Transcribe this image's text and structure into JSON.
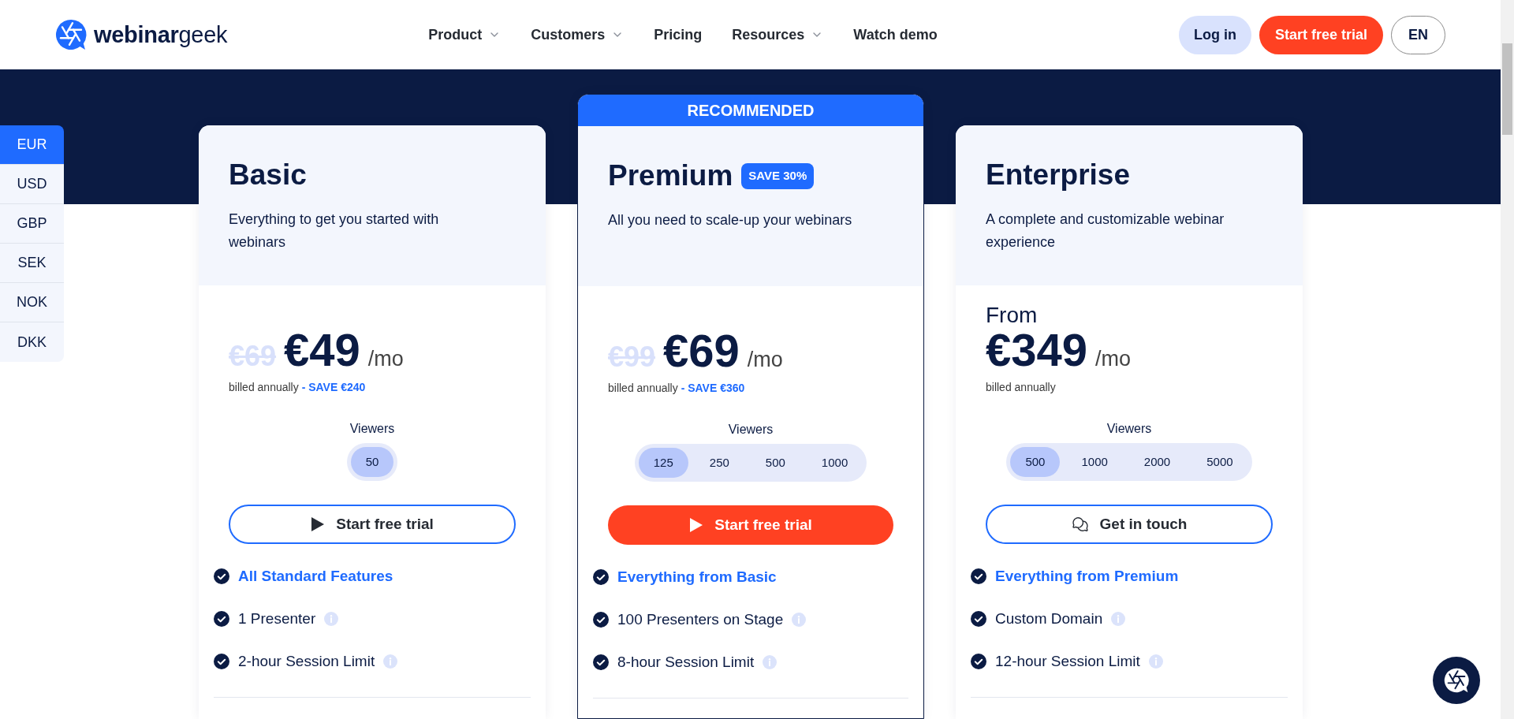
{
  "header": {
    "logo": {
      "wordmark": "**webinar**geek"
    },
    "nav": [
      {
        "label": "Product",
        "dropdown": true
      },
      {
        "label": "Customers",
        "dropdown": true
      },
      {
        "label": "Pricing",
        "dropdown": false
      },
      {
        "label": "Resources",
        "dropdown": true
      },
      {
        "label": "Watch demo",
        "dropdown": false
      }
    ],
    "actions": [
      {
        "label": "Log in",
        "kind": "secondary"
      },
      {
        "label": "Start free trial",
        "kind": "primary"
      },
      {
        "label": "EN",
        "kind": "language"
      }
    ]
  },
  "currencies": [
    {
      "label": "EUR",
      "selected": true
    },
    {
      "label": "USD",
      "selected": false
    },
    {
      "label": "GBP",
      "selected": false
    },
    {
      "label": "SEK",
      "selected": false
    },
    {
      "label": "NOK",
      "selected": false
    },
    {
      "label": "DKK",
      "selected": false
    }
  ],
  "plans": [
    {
      "name": "Basic",
      "description": "Everything to get you started with webinars",
      "highlighted": false,
      "old_price": "€69",
      "price": "€49",
      "period": "/mo",
      "billing": "billed annually **- SAVE €240**",
      "viewers": {
        "label": "Viewers",
        "options": [
          {
            "label": "50",
            "selected": true
          }
        ]
      },
      "cta": {
        "label": "Start free trial",
        "kind": "trial"
      },
      "features": [
        {
          "text": "All Standard Features",
          "kind": "heading",
          "info": false
        },
        {
          "text": "1 Presenter",
          "kind": "item",
          "info": true
        },
        {
          "text": "2-hour Session Limit",
          "kind": "item",
          "info": true
        }
      ]
    },
    {
      "name": "Premium",
      "ribbon": "RECOMMENDED",
      "badge": "SAVE 30%",
      "description": "All you need to scale-up your webinars",
      "highlighted": true,
      "old_price": "€99",
      "price": "€69",
      "period": "/mo",
      "billing": "billed annually **- SAVE €360**",
      "viewers": {
        "label": "Viewers",
        "options": [
          {
            "label": "125",
            "selected": true
          },
          {
            "label": "250",
            "selected": false
          },
          {
            "label": "500",
            "selected": false
          },
          {
            "label": "1000",
            "selected": false
          }
        ]
      },
      "cta": {
        "label": "Start free trial",
        "kind": "trial"
      },
      "features": [
        {
          "text": "Everything from Basic",
          "kind": "heading",
          "info": false
        },
        {
          "text": "100 Presenters on Stage",
          "kind": "item",
          "info": true
        },
        {
          "text": "8-hour Session Limit",
          "kind": "item",
          "info": true
        }
      ]
    },
    {
      "name": "Enterprise",
      "description": "A complete and customizable webinar experience",
      "highlighted": false,
      "prefix": "From",
      "price": "€349",
      "period": "/mo",
      "billing": "billed annually",
      "viewers": {
        "label": "Viewers",
        "options": [
          {
            "label": "500",
            "selected": true
          },
          {
            "label": "1000",
            "selected": false
          },
          {
            "label": "2000",
            "selected": false
          },
          {
            "label": "5000",
            "selected": false
          }
        ]
      },
      "cta": {
        "label": "Get in touch",
        "kind": "contact"
      },
      "features": [
        {
          "text": "Everything from Premium",
          "kind": "heading",
          "info": false
        },
        {
          "text": "Custom Domain",
          "kind": "item",
          "info": true
        },
        {
          "text": "12-hour Session Limit",
          "kind": "item",
          "info": true
        }
      ]
    }
  ]
}
